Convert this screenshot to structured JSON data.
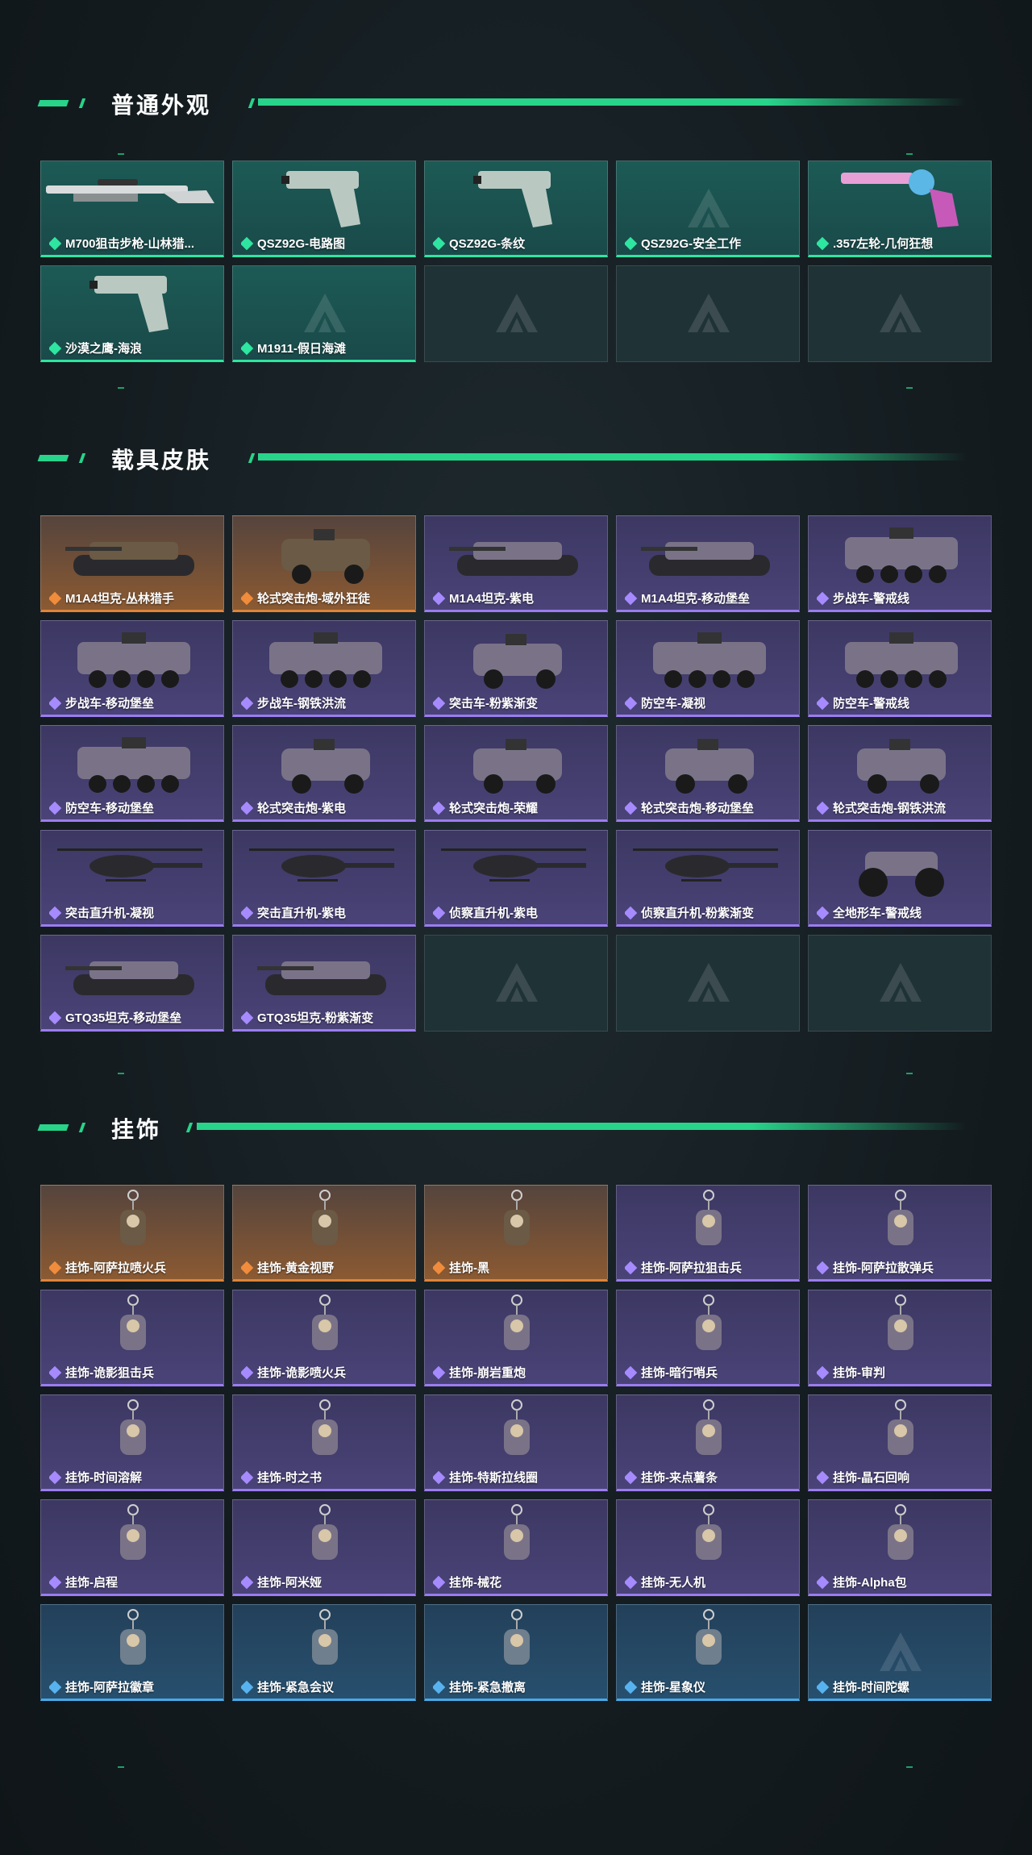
{
  "sections": [
    {
      "title": "普通外观",
      "items": [
        {
          "label": "M700狙击步枪-山林猎...",
          "rarity": "green",
          "kind": "rifle"
        },
        {
          "label": "QSZ92G-电路图",
          "rarity": "green",
          "kind": "pistol"
        },
        {
          "label": "QSZ92G-条纹",
          "rarity": "green",
          "kind": "pistol"
        },
        {
          "label": "QSZ92G-安全工作",
          "rarity": "green",
          "kind": "empty-art"
        },
        {
          "label": ".357左轮-几何狂想",
          "rarity": "green",
          "kind": "revolver"
        },
        {
          "label": "沙漠之鹰-海浪",
          "rarity": "green",
          "kind": "pistol"
        },
        {
          "label": "M1911-假日海滩",
          "rarity": "green",
          "kind": "empty-art"
        },
        {
          "label": "",
          "rarity": "empty"
        },
        {
          "label": "",
          "rarity": "empty"
        },
        {
          "label": "",
          "rarity": "empty"
        }
      ]
    },
    {
      "title": "载具皮肤",
      "items": [
        {
          "label": "M1A4坦克-丛林猎手",
          "rarity": "orange",
          "kind": "tank"
        },
        {
          "label": "轮式突击炮-域外狂徒",
          "rarity": "orange",
          "kind": "car"
        },
        {
          "label": "M1A4坦克-紫电",
          "rarity": "purple",
          "kind": "tank"
        },
        {
          "label": "M1A4坦克-移动堡垒",
          "rarity": "purple",
          "kind": "tank"
        },
        {
          "label": "步战车-警戒线",
          "rarity": "purple",
          "kind": "apc"
        },
        {
          "label": "步战车-移动堡垒",
          "rarity": "purple",
          "kind": "apc"
        },
        {
          "label": "步战车-钢铁洪流",
          "rarity": "purple",
          "kind": "apc"
        },
        {
          "label": "突击车-粉紫渐变",
          "rarity": "purple",
          "kind": "car"
        },
        {
          "label": "防空车-凝视",
          "rarity": "purple",
          "kind": "apc"
        },
        {
          "label": "防空车-警戒线",
          "rarity": "purple",
          "kind": "apc"
        },
        {
          "label": "防空车-移动堡垒",
          "rarity": "purple",
          "kind": "apc"
        },
        {
          "label": "轮式突击炮-紫电",
          "rarity": "purple",
          "kind": "car"
        },
        {
          "label": "轮式突击炮-荣耀",
          "rarity": "purple",
          "kind": "car"
        },
        {
          "label": "轮式突击炮-移动堡垒",
          "rarity": "purple",
          "kind": "car"
        },
        {
          "label": "轮式突击炮-钢铁洪流",
          "rarity": "purple",
          "kind": "car"
        },
        {
          "label": "突击直升机-凝视",
          "rarity": "purple",
          "kind": "heli"
        },
        {
          "label": "突击直升机-紫电",
          "rarity": "purple",
          "kind": "heli"
        },
        {
          "label": "侦察直升机-紫电",
          "rarity": "purple",
          "kind": "heli"
        },
        {
          "label": "侦察直升机-粉紫渐变",
          "rarity": "purple",
          "kind": "heli"
        },
        {
          "label": "全地形车-警戒线",
          "rarity": "purple",
          "kind": "atv"
        },
        {
          "label": "GTQ35坦克-移动堡垒",
          "rarity": "purple",
          "kind": "tank"
        },
        {
          "label": "GTQ35坦克-粉紫渐变",
          "rarity": "purple",
          "kind": "tank"
        },
        {
          "label": "",
          "rarity": "empty"
        },
        {
          "label": "",
          "rarity": "empty"
        },
        {
          "label": "",
          "rarity": "empty"
        }
      ]
    },
    {
      "title": "挂饰",
      "items": [
        {
          "label": "挂饰-阿萨拉喷火兵",
          "rarity": "orange",
          "kind": "charm"
        },
        {
          "label": "挂饰-黄金视野",
          "rarity": "orange",
          "kind": "charm"
        },
        {
          "label": "挂饰-黑",
          "rarity": "orange",
          "kind": "charm"
        },
        {
          "label": "挂饰-阿萨拉狙击兵",
          "rarity": "purple",
          "kind": "charm"
        },
        {
          "label": "挂饰-阿萨拉散弹兵",
          "rarity": "purple",
          "kind": "charm"
        },
        {
          "label": "挂饰-诡影狙击兵",
          "rarity": "purple",
          "kind": "charm"
        },
        {
          "label": "挂饰-诡影喷火兵",
          "rarity": "purple",
          "kind": "charm"
        },
        {
          "label": "挂饰-崩岩重炮",
          "rarity": "purple",
          "kind": "charm"
        },
        {
          "label": "挂饰-暗行哨兵",
          "rarity": "purple",
          "kind": "charm"
        },
        {
          "label": "挂饰-审判",
          "rarity": "purple",
          "kind": "charm"
        },
        {
          "label": "挂饰-时间溶解",
          "rarity": "purple",
          "kind": "charm"
        },
        {
          "label": "挂饰-时之书",
          "rarity": "purple",
          "kind": "charm"
        },
        {
          "label": "挂饰-特斯拉线圈",
          "rarity": "purple",
          "kind": "charm"
        },
        {
          "label": "挂饰-来点薯条",
          "rarity": "purple",
          "kind": "charm"
        },
        {
          "label": "挂饰-晶石回响",
          "rarity": "purple",
          "kind": "charm"
        },
        {
          "label": "挂饰-启程",
          "rarity": "purple",
          "kind": "charm"
        },
        {
          "label": "挂饰-阿米娅",
          "rarity": "purple",
          "kind": "charm"
        },
        {
          "label": "挂饰-械花",
          "rarity": "purple",
          "kind": "charm"
        },
        {
          "label": "挂饰-无人机",
          "rarity": "purple",
          "kind": "charm"
        },
        {
          "label": "挂饰-Alpha包",
          "rarity": "purple",
          "kind": "charm"
        },
        {
          "label": "挂饰-阿萨拉徽章",
          "rarity": "blue",
          "kind": "charm"
        },
        {
          "label": "挂饰-紧急会议",
          "rarity": "blue",
          "kind": "charm"
        },
        {
          "label": "挂饰-紧急撤离",
          "rarity": "blue",
          "kind": "charm"
        },
        {
          "label": "挂饰-星象仪",
          "rarity": "blue",
          "kind": "charm"
        },
        {
          "label": "挂饰-时间陀螺",
          "rarity": "blue",
          "kind": "empty-art"
        }
      ]
    }
  ]
}
